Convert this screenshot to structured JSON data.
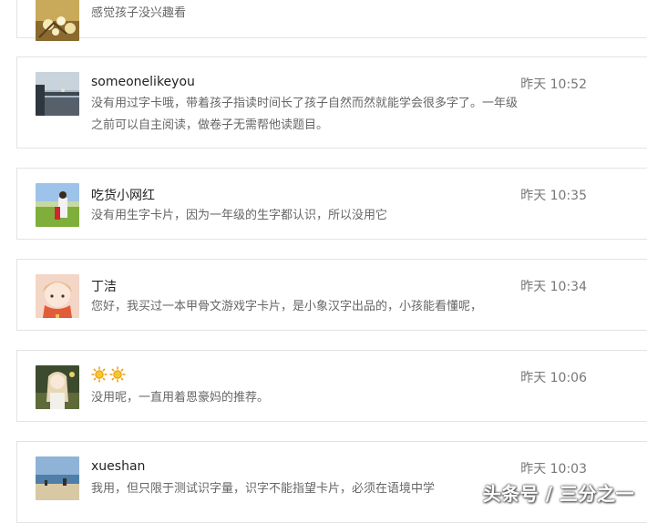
{
  "comments": [
    {
      "user": "",
      "time": "",
      "text": "感觉孩子没兴趣看",
      "avatar": "flower-avatar"
    },
    {
      "user": "someonelikeyou",
      "time": "昨天 10:52",
      "text": "没有用过字卡哦，带着孩子指读时间长了孩子自然而然就能学会很多字了。一年级之前可以自主阅读，做卷子无需帮他读题目。",
      "avatar": "airport-avatar"
    },
    {
      "user": "吃货小网红",
      "time": "昨天 10:35",
      "text": "没有用生字卡片，因为一年级的生字都认识，所以没用它",
      "avatar": "girl-field-avatar"
    },
    {
      "user": "丁洁",
      "time": "昨天 10:34",
      "text": "您好，我买过一本甲骨文游戏字卡片，是小象汉字出品的，小孩能看懂呢，",
      "avatar": "cartoon-girl-avatar"
    },
    {
      "user": "",
      "time": "昨天 10:06",
      "text": "没用呢，一直用着恩豪妈的推荐。",
      "avatar": "anime-girl-avatar",
      "name_icons": [
        "sun-icon",
        "sun-icon"
      ]
    },
    {
      "user": "xueshan",
      "time": "昨天 10:03",
      "text": "我用，但只限于测试识字量，识字不能指望卡片，必须在语境中学",
      "avatar": "beach-avatar"
    }
  ],
  "watermark": "头条号 / 三分之一"
}
